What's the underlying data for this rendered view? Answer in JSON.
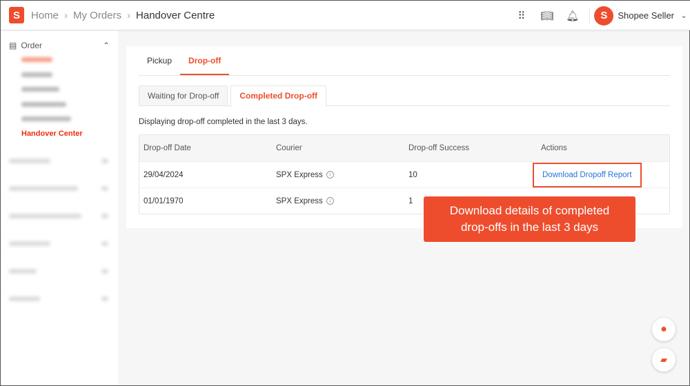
{
  "header": {
    "logo": "S",
    "breadcrumb": [
      "Home",
      "My Orders",
      "Handover Centre"
    ],
    "icons": [
      "apps-grid-icon",
      "book-icon",
      "bell-icon"
    ],
    "user": "Shopee Seller"
  },
  "sidebar": {
    "section": "Order",
    "active_item": "Handover Center"
  },
  "tabs": [
    "Pickup",
    "Drop-off"
  ],
  "subtabs": [
    "Waiting for Drop-off",
    "Completed Drop-off"
  ],
  "note": "Displaying drop-off completed in the last 3 days.",
  "table": {
    "headers": [
      "Drop-off Date",
      "Courier",
      "Drop-off Success",
      "Actions"
    ],
    "rows": [
      {
        "date": "29/04/2024",
        "courier": "SPX Express",
        "success": "10",
        "action": "Download Dropoff Report"
      },
      {
        "date": "01/01/1970",
        "courier": "SPX Express",
        "success": "1",
        "action": ""
      }
    ]
  },
  "callout": {
    "line1": "Download details of completed",
    "line2": "drop-offs in the last 3 days"
  },
  "accent": "#ee4d2d"
}
